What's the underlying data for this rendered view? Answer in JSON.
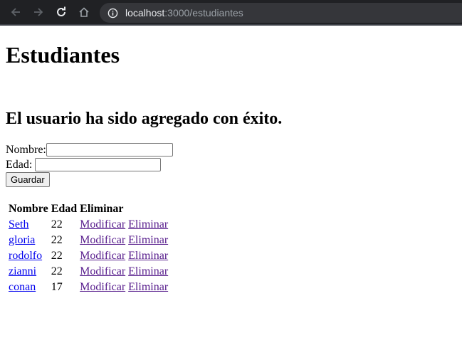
{
  "browser": {
    "url_host": "localhost",
    "url_rest": ":3000/estudiantes"
  },
  "page": {
    "title": "Estudiantes",
    "message": "El usuario ha sido agregado con éxito."
  },
  "form": {
    "nombre_label": "Nombre:",
    "edad_label": "Edad:",
    "nombre_value": "",
    "edad_value": "",
    "save_label": "Guardar"
  },
  "table": {
    "headers": [
      "Nombre",
      "Edad",
      "Eliminar"
    ],
    "rows": [
      {
        "nombre": "Seth",
        "edad": "22",
        "modificar": "Modificar",
        "eliminar": "Eliminar"
      },
      {
        "nombre": "gloria",
        "edad": "22",
        "modificar": "Modificar",
        "eliminar": "Eliminar"
      },
      {
        "nombre": "rodolfo",
        "edad": "22",
        "modificar": "Modificar",
        "eliminar": "Eliminar"
      },
      {
        "nombre": "zianni",
        "edad": "22",
        "modificar": "Modificar",
        "eliminar": "Eliminar"
      },
      {
        "nombre": "conan",
        "edad": "17",
        "modificar": "Modificar",
        "eliminar": "Eliminar"
      }
    ]
  }
}
